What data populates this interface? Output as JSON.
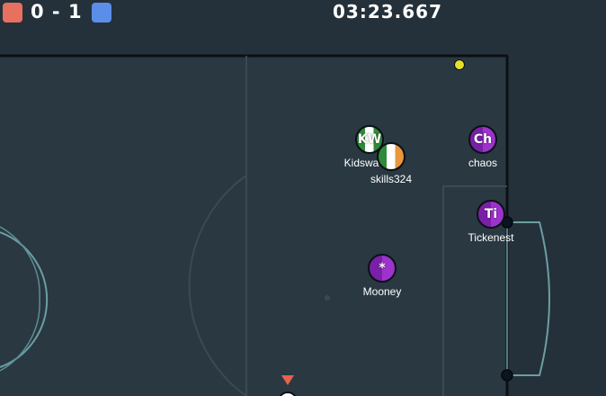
{
  "scoreboard": {
    "red_color": "#e8705e",
    "blue_color": "#5b8ee8",
    "score_text": "0 - 1",
    "timer": "03:23.667"
  },
  "ball": {
    "color": "#e6e02a"
  },
  "players": [
    {
      "name": "Kidswa",
      "avatar": "KW",
      "team": "red",
      "style": "flag-green-white"
    },
    {
      "name": "skills324",
      "avatar": "",
      "team": "red",
      "style": "flag-green-white-orange"
    },
    {
      "name": "chaos",
      "avatar": "Ch",
      "team": "blue",
      "style": "purple"
    },
    {
      "name": "Tickenest",
      "avatar": "Ti",
      "team": "blue",
      "style": "purple"
    },
    {
      "name": "Mooney",
      "avatar": "*",
      "team": "blue",
      "style": "purple"
    }
  ],
  "offscreen_marker": {
    "color": "#e8614f"
  }
}
